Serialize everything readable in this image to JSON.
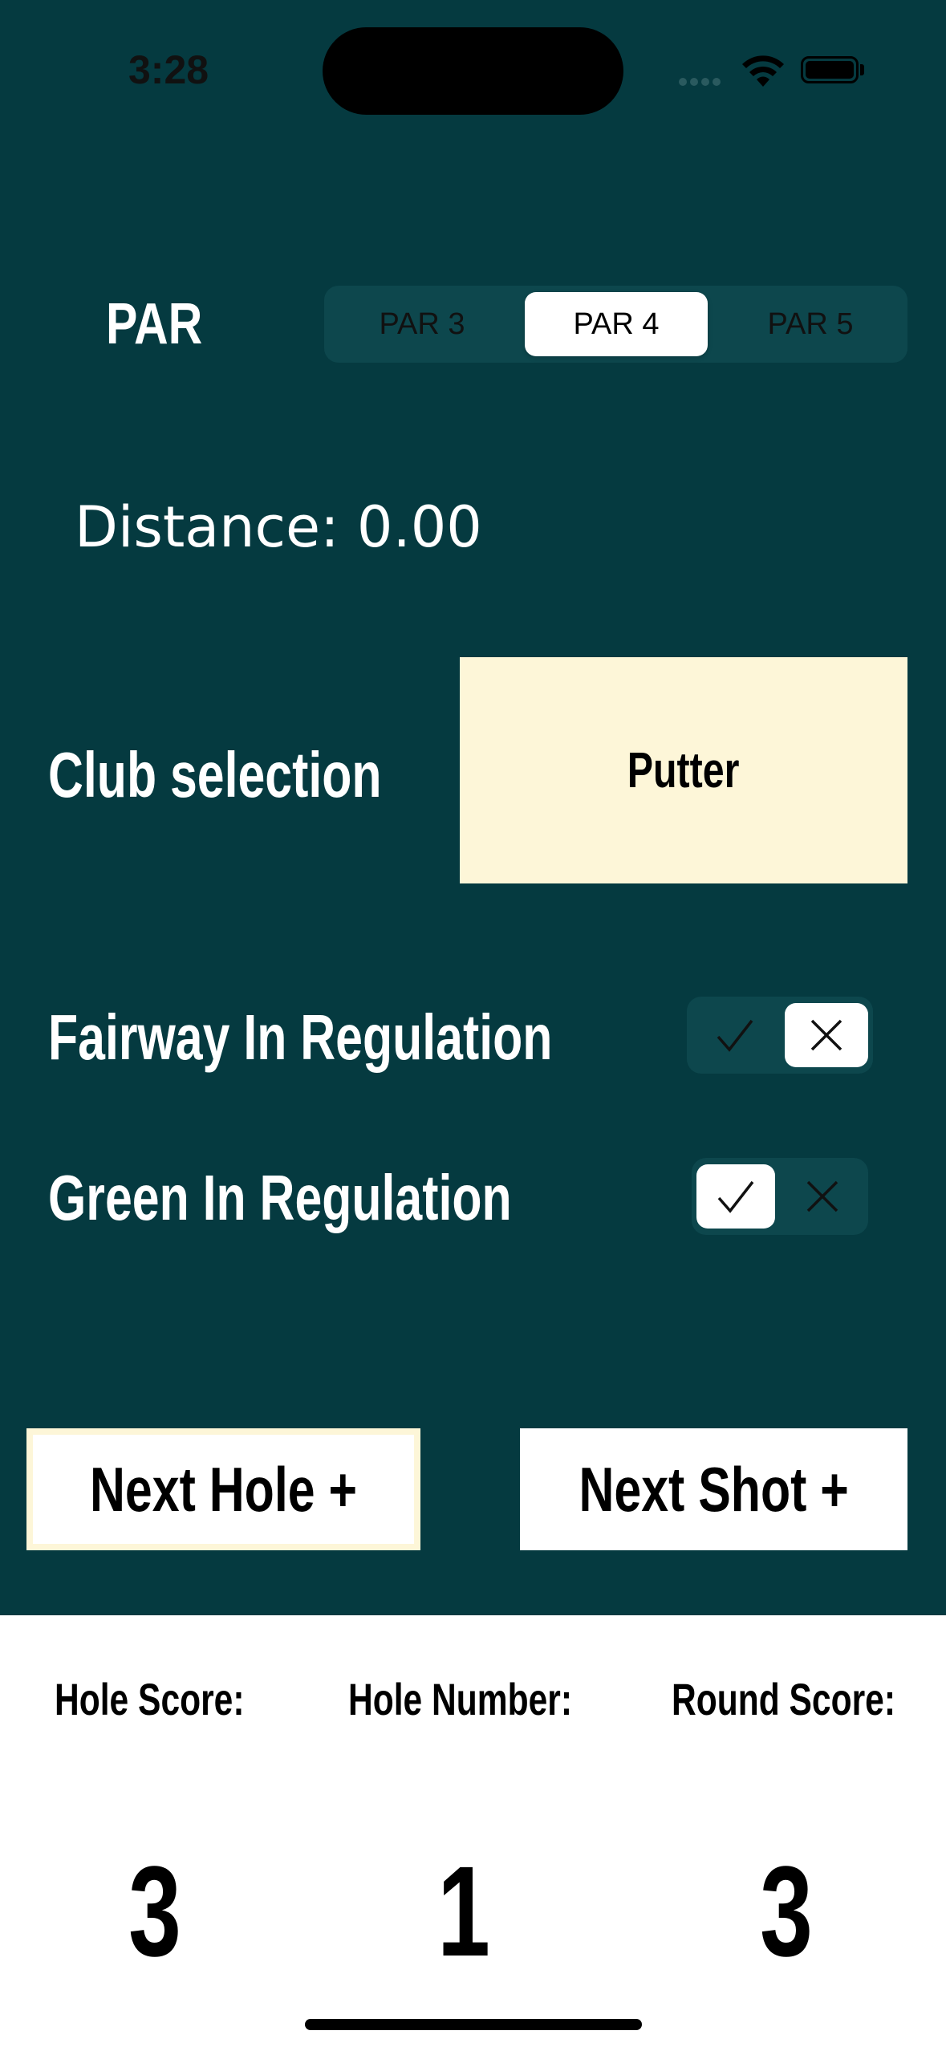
{
  "status_bar": {
    "time": "3:28",
    "wifi_icon": "wifi-icon",
    "battery_icon": "battery-icon"
  },
  "par": {
    "label": "PAR",
    "options": [
      "PAR 3",
      "PAR 4",
      "PAR 5"
    ],
    "selected": "PAR 4"
  },
  "distance": {
    "text": "Distance: 0.00"
  },
  "club": {
    "label": "Club selection",
    "value": "Putter"
  },
  "fairway": {
    "label": "Fairway In Regulation",
    "selected": "x"
  },
  "green": {
    "label": "Green In Regulation",
    "selected": "check"
  },
  "buttons": {
    "next_hole": "Next Hole +",
    "next_shot": "Next Shot +"
  },
  "stats": {
    "hole_score_label": "Hole Score:",
    "hole_number_label": "Hole Number:",
    "round_score_label": "Round Score:",
    "hole_score": "3",
    "hole_number": "1",
    "round_score": "3"
  },
  "colors": {
    "background": "#053a40",
    "segment_bg": "#0d474d",
    "club_box": "#fdf6d8",
    "bottom_panel": "#ffffff"
  }
}
